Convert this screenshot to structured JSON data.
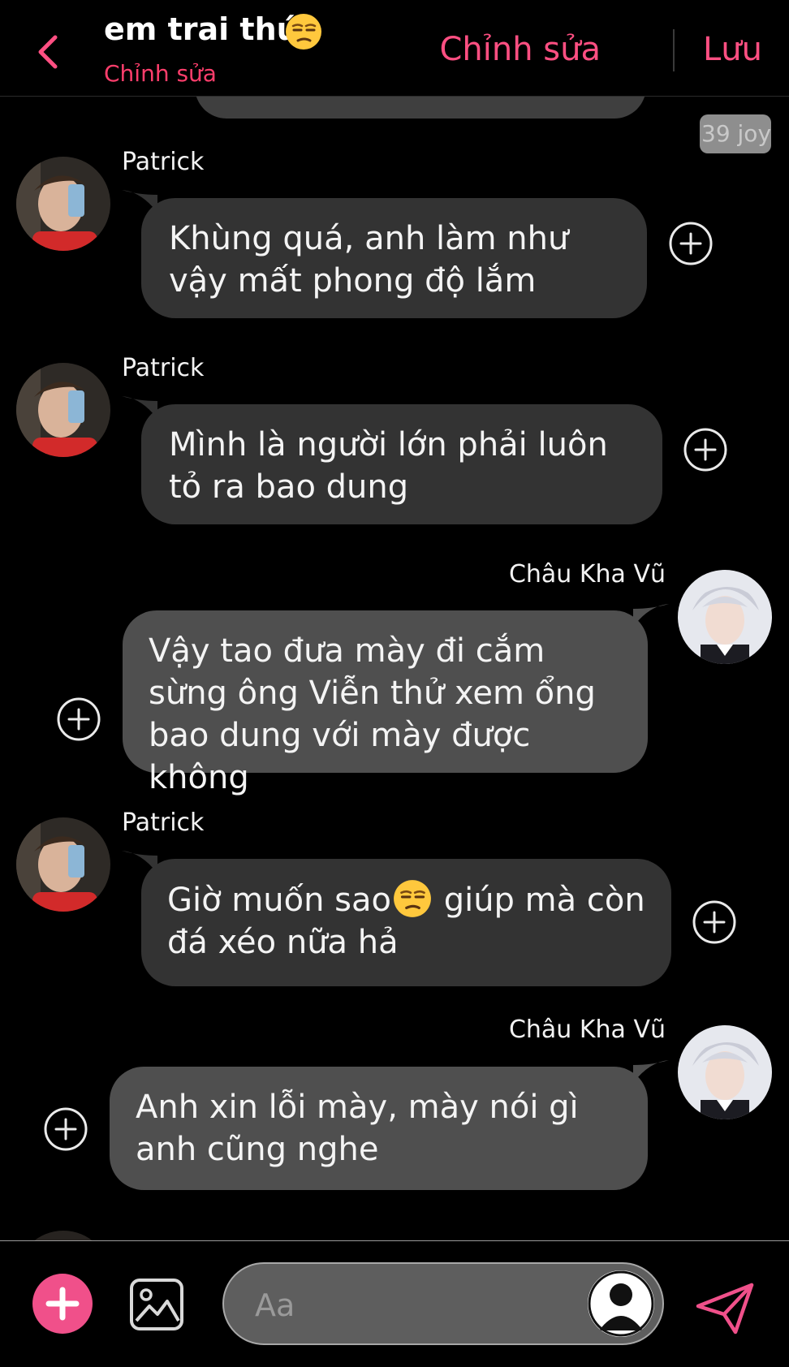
{
  "header": {
    "title": "em trai thúi",
    "title_emoji": "unamused-face-icon",
    "subtitle": "Chỉnh sửa",
    "edit_label": "Chỉnh sửa",
    "save_label": "Lưu",
    "accent_color": "#ff4f82"
  },
  "chat": {
    "reaction_badge": "39 joy",
    "messages": [
      {
        "sender": "Patrick",
        "direction": "incoming",
        "text": "Khùng quá, anh làm như vậy mất phong độ lắm"
      },
      {
        "sender": "Patrick",
        "direction": "incoming",
        "text": "Mình là người lớn phải luôn tỏ ra bao dung"
      },
      {
        "sender": "Châu Kha Vũ",
        "direction": "outgoing",
        "text": "Vậy tao đưa mày đi cắm sừng ông Viễn thử xem ổng bao dung với mày được không"
      },
      {
        "sender": "Patrick",
        "direction": "incoming",
        "text_before": "Giờ muốn sao",
        "emoji": "unamused-face-icon",
        "text_after": "giúp mà còn đá xéo nữa hả"
      },
      {
        "sender": "Châu Kha Vũ",
        "direction": "outgoing",
        "text": "Anh xin lỗi mày, mày nói gì anh cũng nghe"
      }
    ]
  },
  "composer": {
    "placeholder": "Aa",
    "plus_color": "#f0508a"
  }
}
